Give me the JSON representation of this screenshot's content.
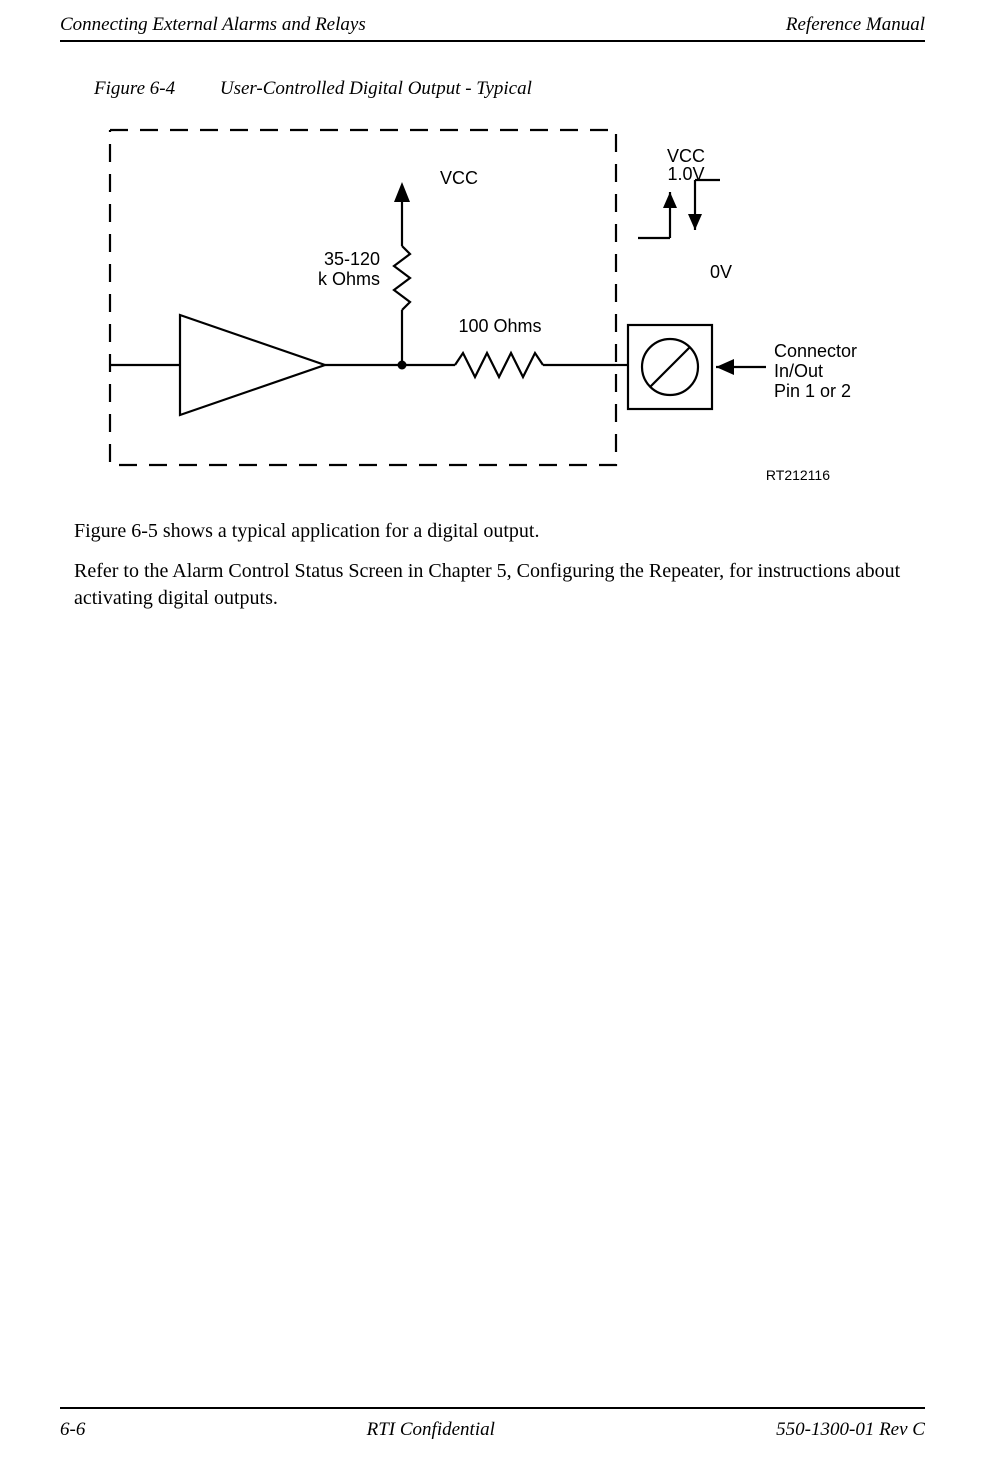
{
  "header": {
    "left": "Connecting External Alarms and Relays",
    "right": "Reference Manual"
  },
  "figure": {
    "label": "Figure 6-4",
    "title": "User-Controlled Digital Output - Typical",
    "drawing_id": "RT212116",
    "labels": {
      "vcc": "VCC",
      "resistor_pullup": "35-120\nk Ohms",
      "resistor_series": "100 Ohms",
      "vcc_level": "VCC\n1.0V",
      "zero_v": "0V",
      "connector_line1": "Connector",
      "connector_line2": "In/Out",
      "connector_line3": "Pin 1 or 2"
    }
  },
  "paragraphs": {
    "p1": "Figure 6-5 shows a typical application for a digital output.",
    "p2": "Refer to the Alarm Control Status Screen in Chapter 5, Configuring the Repeater, for instructions about activating digital outputs."
  },
  "footer": {
    "left": "6-6",
    "center": "RTI Confidential",
    "right": "550-1300-01 Rev C"
  }
}
